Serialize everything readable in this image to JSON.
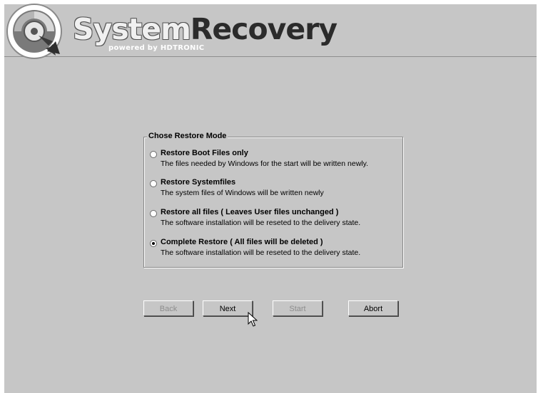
{
  "header": {
    "brand_part1": "System",
    "brand_part2": "Recovery",
    "brand_sub": "powered by HDTRONIC"
  },
  "mode_group": {
    "title": "Chose Restore Mode",
    "options": [
      {
        "label": "Restore Boot Files only",
        "description": "The files needed by Windows for the start will be written newly.",
        "checked": false
      },
      {
        "label": "Restore Systemfiles",
        "description": "The system files of Windows will be written newly",
        "checked": false
      },
      {
        "label": "Restore all files ( Leaves User files unchanged )",
        "description": "The software installation will be reseted to the delivery state.",
        "checked": false
      },
      {
        "label": "Complete Restore ( All files will be deleted )",
        "description": "The software installation will be reseted to the delivery state.",
        "checked": true
      }
    ]
  },
  "buttons": {
    "back": "Back",
    "next": "Next",
    "start": "Start",
    "abort": "Abort"
  },
  "colors": {
    "background": "#c6c6c6",
    "disabled_text": "#8d8d8d"
  }
}
